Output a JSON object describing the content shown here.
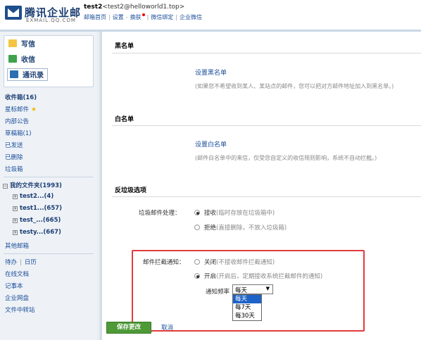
{
  "header": {
    "logo_text": "腾讯企业邮",
    "logo_sub": "EXMAIL.QQ.COM",
    "account_name": "test2",
    "account_email": "<test2@helloworld1.top>",
    "links": [
      "邮箱首页",
      "设置",
      "换肤",
      "微信绑定",
      "企业微信"
    ]
  },
  "sidebar": {
    "compose": "写信",
    "inbox": "收信",
    "contacts": "通讯录",
    "folders": [
      {
        "label": "收件箱(16)"
      },
      {
        "label": "星标邮件"
      },
      {
        "label": "内部公告"
      },
      {
        "label": "草稿箱(1)"
      },
      {
        "label": "已发送"
      },
      {
        "label": "已删除"
      },
      {
        "label": "垃圾箱"
      }
    ],
    "my_folders": "我的文件夹(1993)",
    "sub_folders": [
      {
        "label": "test2...(4)"
      },
      {
        "label": "test1...(657)"
      },
      {
        "label": "test_...(665)"
      },
      {
        "label": "testy...(667)"
      }
    ],
    "other_mailbox": "其他邮箱",
    "tools": [
      "待办",
      "日历"
    ],
    "tools_sep": "|",
    "extra": [
      {
        "label": "在线文档"
      },
      {
        "label": "记事本"
      },
      {
        "label": "企业网盘"
      },
      {
        "label": "文件中转站"
      }
    ]
  },
  "main": {
    "blacklist": {
      "title": "黑名单",
      "link": "设置黑名单",
      "hint": "(如果您不希望收到某人、某站点的邮件，您可以把对方邮件地址加入到黑名单。)"
    },
    "whitelist": {
      "title": "白名单",
      "link": "设置白名单",
      "hint": "(邮件白名单中的来信，仅受您自定义的收信规则影响，系统不自动拦截。)"
    },
    "antispam": {
      "title": "反垃圾选项",
      "spam_label": "垃圾邮件处理：",
      "spam_options": [
        {
          "label": "接收",
          "note": "(临时存放在垃圾箱中)"
        },
        {
          "label": "拒绝",
          "note": "(直接删除，不放入垃圾箱)"
        }
      ],
      "notify_label": "邮件拦截通知：",
      "notify_options": [
        {
          "label": "关闭",
          "note": "(不接收邮件拦截通知)"
        },
        {
          "label": "开启",
          "note": "(开启后，定期接收系统拦截邮件的通知)"
        }
      ],
      "freq_label": "通知频率",
      "freq_selected": "每天",
      "freq_options": [
        "每天",
        "每7天",
        "每30天"
      ]
    },
    "save_label": "保存更改",
    "cancel_label": "取消"
  },
  "colors": {
    "accent": "#1b4e9a",
    "save_green": "#4d9a37",
    "highlight_red": "#e23b3b",
    "dropdown_highlight": "#1e63c7"
  }
}
